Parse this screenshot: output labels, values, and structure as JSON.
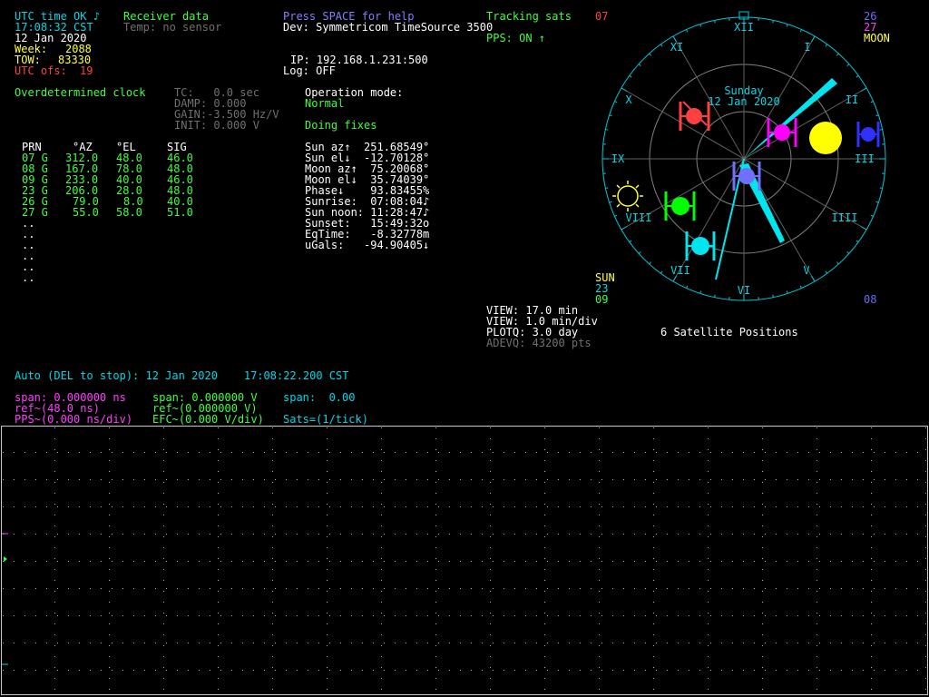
{
  "status": {
    "utc_ok": "UTC time OK ♪",
    "time": "17:08:32 CST",
    "date": "12 Jan 2020",
    "week_label": "Week:",
    "week": "2088",
    "tow_label": "TOW:",
    "tow": "83330",
    "utc_ofs_label": "UTC ofs:",
    "utc_ofs": "19"
  },
  "receiver": {
    "title": "Receiver data",
    "temp": "Temp: no sensor"
  },
  "help": {
    "press_space": "Press SPACE for help",
    "dev": "Dev: Symmetricom TimeSource 3500",
    "ip": "IP: 192.168.1.231:500",
    "log": "Log: OFF"
  },
  "tracking": {
    "label": "Tracking sats",
    "count": "07",
    "pps": "PPS: ON ↑"
  },
  "clock": {
    "title": "Overdetermined clock",
    "tc": "TC:   0.0 sec",
    "damp": "DAMP: 0.000",
    "gain": "GAIN:-3.500 Hz/V",
    "init": "INIT: 0.000 V"
  },
  "opmode": {
    "label": "Operation mode:",
    "mode": "Normal",
    "fixes": "Doing fixes"
  },
  "sat_table": {
    "headers": [
      "PRN",
      "°AZ",
      "°EL",
      "SIG"
    ],
    "rows": [
      {
        "prn": "07 G",
        "az": "312.0",
        "el": "48.0",
        "sig": "46.0"
      },
      {
        "prn": "08 G",
        "az": "167.0",
        "el": "78.0",
        "sig": "48.0"
      },
      {
        "prn": "09 G",
        "az": "233.0",
        "el": "40.0",
        "sig": "46.0"
      },
      {
        "prn": "23 G",
        "az": "206.0",
        "el": "28.0",
        "sig": "48.0"
      },
      {
        "prn": "26 G",
        "az": "79.0",
        "el": "8.0",
        "sig": "40.0"
      },
      {
        "prn": "27 G",
        "az": "55.0",
        "el": "58.0",
        "sig": "51.0"
      }
    ],
    "placeholder": ".."
  },
  "astro": {
    "sun_az": "Sun az↑  251.68549°",
    "sun_el": "Sun el↓  -12.70128°",
    "moon_az": "Moon az↑  75.20068°",
    "moon_el": "Moon el↓  35.74039°",
    "phase": "Phase↓    93.83455%",
    "sunrise": "Sunrise:  07:08:04♪",
    "sun_noon": "Sun noon: 11:28:47♪",
    "sunset": "Sunset:   15:49:32o",
    "eqtime": "EqTime:   -8.32778m",
    "ugals": "uGals:   -94.90405↓"
  },
  "legend": {
    "sat26": "26",
    "sat27": "27",
    "moon": "MOON",
    "sun": "SUN",
    "sat23": "23",
    "sat09": "09",
    "sat08": "08"
  },
  "dial": {
    "day": "Sunday",
    "date": "12 Jan 2020",
    "hours": [
      "XII",
      "I",
      "II",
      "III",
      "IIII",
      "V",
      "VI",
      "VII",
      "VIII",
      "IX",
      "X",
      "XI"
    ],
    "caption": "6 Satellite Positions"
  },
  "view": {
    "view1": "VIEW: 17.0 min",
    "view2": "VIEW: 1.0 min/div",
    "plotq": "PLOTQ: 3.0 day",
    "adevq": "ADEVQ: 43200 pts"
  },
  "plot": {
    "auto": "Auto (DEL to stop): 12 Jan 2020    17:08:22.200 CST",
    "span_ns": "span: 0.000000 ns",
    "span_v": "span: 0.000000 V",
    "span_plain": "span:  0.00",
    "ref_ns": "ref~(48.0 ns)",
    "ref_v": "ref~(0.000000 V)",
    "pps_div": "PPS~(0.000 ns/div)",
    "efc_div": "EFC~(0.000 V/div)",
    "sats_tick": "Sats=(1/tick)"
  },
  "colors": {
    "cyan": "#00d8e8",
    "yellow": "#ffff40",
    "red": "#ff4040",
    "green": "#40ff40",
    "magenta": "#ff40ff",
    "blue": "#8080ff",
    "grid": "#b0b0b0"
  }
}
